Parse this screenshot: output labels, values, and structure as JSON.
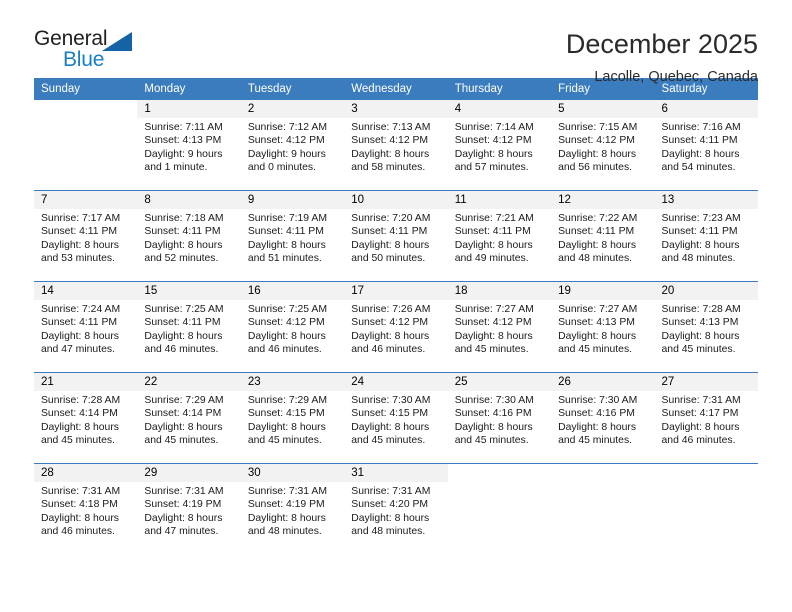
{
  "brand": {
    "name_top": "General",
    "name_bottom": "Blue",
    "color_blue": "#1a7fc1",
    "triangle_color": "#1464a5"
  },
  "header": {
    "title": "December 2025",
    "subtitle": "Lacolle, Quebec, Canada"
  },
  "theme": {
    "header_bg": "#3a7cbe",
    "daynum_bg": "#f2f2f2",
    "grid_line": "#3a7cbe"
  },
  "weekdays": [
    "Sunday",
    "Monday",
    "Tuesday",
    "Wednesday",
    "Thursday",
    "Friday",
    "Saturday"
  ],
  "labels": {
    "sunrise_prefix": "Sunrise:",
    "sunset_prefix": "Sunset:",
    "daylight_prefix": "Daylight:"
  },
  "weeks": [
    [
      {
        "day": "",
        "sunrise": "",
        "sunset": "",
        "daylight_line1": "",
        "daylight_line2": "",
        "blank": true
      },
      {
        "day": "1",
        "sunrise": "Sunrise: 7:11 AM",
        "sunset": "Sunset: 4:13 PM",
        "daylight_line1": "Daylight: 9 hours",
        "daylight_line2": "and 1 minute."
      },
      {
        "day": "2",
        "sunrise": "Sunrise: 7:12 AM",
        "sunset": "Sunset: 4:12 PM",
        "daylight_line1": "Daylight: 9 hours",
        "daylight_line2": "and 0 minutes."
      },
      {
        "day": "3",
        "sunrise": "Sunrise: 7:13 AM",
        "sunset": "Sunset: 4:12 PM",
        "daylight_line1": "Daylight: 8 hours",
        "daylight_line2": "and 58 minutes."
      },
      {
        "day": "4",
        "sunrise": "Sunrise: 7:14 AM",
        "sunset": "Sunset: 4:12 PM",
        "daylight_line1": "Daylight: 8 hours",
        "daylight_line2": "and 57 minutes."
      },
      {
        "day": "5",
        "sunrise": "Sunrise: 7:15 AM",
        "sunset": "Sunset: 4:12 PM",
        "daylight_line1": "Daylight: 8 hours",
        "daylight_line2": "and 56 minutes."
      },
      {
        "day": "6",
        "sunrise": "Sunrise: 7:16 AM",
        "sunset": "Sunset: 4:11 PM",
        "daylight_line1": "Daylight: 8 hours",
        "daylight_line2": "and 54 minutes."
      }
    ],
    [
      {
        "day": "7",
        "sunrise": "Sunrise: 7:17 AM",
        "sunset": "Sunset: 4:11 PM",
        "daylight_line1": "Daylight: 8 hours",
        "daylight_line2": "and 53 minutes."
      },
      {
        "day": "8",
        "sunrise": "Sunrise: 7:18 AM",
        "sunset": "Sunset: 4:11 PM",
        "daylight_line1": "Daylight: 8 hours",
        "daylight_line2": "and 52 minutes."
      },
      {
        "day": "9",
        "sunrise": "Sunrise: 7:19 AM",
        "sunset": "Sunset: 4:11 PM",
        "daylight_line1": "Daylight: 8 hours",
        "daylight_line2": "and 51 minutes."
      },
      {
        "day": "10",
        "sunrise": "Sunrise: 7:20 AM",
        "sunset": "Sunset: 4:11 PM",
        "daylight_line1": "Daylight: 8 hours",
        "daylight_line2": "and 50 minutes."
      },
      {
        "day": "11",
        "sunrise": "Sunrise: 7:21 AM",
        "sunset": "Sunset: 4:11 PM",
        "daylight_line1": "Daylight: 8 hours",
        "daylight_line2": "and 49 minutes."
      },
      {
        "day": "12",
        "sunrise": "Sunrise: 7:22 AM",
        "sunset": "Sunset: 4:11 PM",
        "daylight_line1": "Daylight: 8 hours",
        "daylight_line2": "and 48 minutes."
      },
      {
        "day": "13",
        "sunrise": "Sunrise: 7:23 AM",
        "sunset": "Sunset: 4:11 PM",
        "daylight_line1": "Daylight: 8 hours",
        "daylight_line2": "and 48 minutes."
      }
    ],
    [
      {
        "day": "14",
        "sunrise": "Sunrise: 7:24 AM",
        "sunset": "Sunset: 4:11 PM",
        "daylight_line1": "Daylight: 8 hours",
        "daylight_line2": "and 47 minutes."
      },
      {
        "day": "15",
        "sunrise": "Sunrise: 7:25 AM",
        "sunset": "Sunset: 4:11 PM",
        "daylight_line1": "Daylight: 8 hours",
        "daylight_line2": "and 46 minutes."
      },
      {
        "day": "16",
        "sunrise": "Sunrise: 7:25 AM",
        "sunset": "Sunset: 4:12 PM",
        "daylight_line1": "Daylight: 8 hours",
        "daylight_line2": "and 46 minutes."
      },
      {
        "day": "17",
        "sunrise": "Sunrise: 7:26 AM",
        "sunset": "Sunset: 4:12 PM",
        "daylight_line1": "Daylight: 8 hours",
        "daylight_line2": "and 46 minutes."
      },
      {
        "day": "18",
        "sunrise": "Sunrise: 7:27 AM",
        "sunset": "Sunset: 4:12 PM",
        "daylight_line1": "Daylight: 8 hours",
        "daylight_line2": "and 45 minutes."
      },
      {
        "day": "19",
        "sunrise": "Sunrise: 7:27 AM",
        "sunset": "Sunset: 4:13 PM",
        "daylight_line1": "Daylight: 8 hours",
        "daylight_line2": "and 45 minutes."
      },
      {
        "day": "20",
        "sunrise": "Sunrise: 7:28 AM",
        "sunset": "Sunset: 4:13 PM",
        "daylight_line1": "Daylight: 8 hours",
        "daylight_line2": "and 45 minutes."
      }
    ],
    [
      {
        "day": "21",
        "sunrise": "Sunrise: 7:28 AM",
        "sunset": "Sunset: 4:14 PM",
        "daylight_line1": "Daylight: 8 hours",
        "daylight_line2": "and 45 minutes."
      },
      {
        "day": "22",
        "sunrise": "Sunrise: 7:29 AM",
        "sunset": "Sunset: 4:14 PM",
        "daylight_line1": "Daylight: 8 hours",
        "daylight_line2": "and 45 minutes."
      },
      {
        "day": "23",
        "sunrise": "Sunrise: 7:29 AM",
        "sunset": "Sunset: 4:15 PM",
        "daylight_line1": "Daylight: 8 hours",
        "daylight_line2": "and 45 minutes."
      },
      {
        "day": "24",
        "sunrise": "Sunrise: 7:30 AM",
        "sunset": "Sunset: 4:15 PM",
        "daylight_line1": "Daylight: 8 hours",
        "daylight_line2": "and 45 minutes."
      },
      {
        "day": "25",
        "sunrise": "Sunrise: 7:30 AM",
        "sunset": "Sunset: 4:16 PM",
        "daylight_line1": "Daylight: 8 hours",
        "daylight_line2": "and 45 minutes."
      },
      {
        "day": "26",
        "sunrise": "Sunrise: 7:30 AM",
        "sunset": "Sunset: 4:16 PM",
        "daylight_line1": "Daylight: 8 hours",
        "daylight_line2": "and 45 minutes."
      },
      {
        "day": "27",
        "sunrise": "Sunrise: 7:31 AM",
        "sunset": "Sunset: 4:17 PM",
        "daylight_line1": "Daylight: 8 hours",
        "daylight_line2": "and 46 minutes."
      }
    ],
    [
      {
        "day": "28",
        "sunrise": "Sunrise: 7:31 AM",
        "sunset": "Sunset: 4:18 PM",
        "daylight_line1": "Daylight: 8 hours",
        "daylight_line2": "and 46 minutes."
      },
      {
        "day": "29",
        "sunrise": "Sunrise: 7:31 AM",
        "sunset": "Sunset: 4:19 PM",
        "daylight_line1": "Daylight: 8 hours",
        "daylight_line2": "and 47 minutes."
      },
      {
        "day": "30",
        "sunrise": "Sunrise: 7:31 AM",
        "sunset": "Sunset: 4:19 PM",
        "daylight_line1": "Daylight: 8 hours",
        "daylight_line2": "and 48 minutes."
      },
      {
        "day": "31",
        "sunrise": "Sunrise: 7:31 AM",
        "sunset": "Sunset: 4:20 PM",
        "daylight_line1": "Daylight: 8 hours",
        "daylight_line2": "and 48 minutes."
      },
      {
        "day": "",
        "sunrise": "",
        "sunset": "",
        "daylight_line1": "",
        "daylight_line2": "",
        "blank": true
      },
      {
        "day": "",
        "sunrise": "",
        "sunset": "",
        "daylight_line1": "",
        "daylight_line2": "",
        "blank": true
      },
      {
        "day": "",
        "sunrise": "",
        "sunset": "",
        "daylight_line1": "",
        "daylight_line2": "",
        "blank": true
      }
    ]
  ]
}
